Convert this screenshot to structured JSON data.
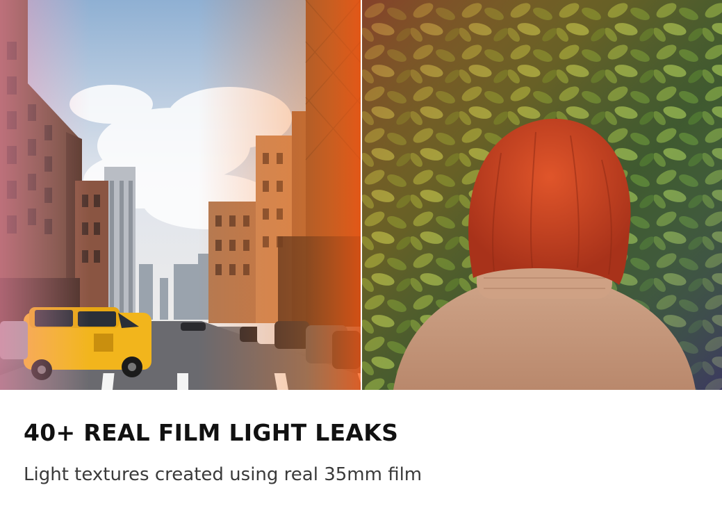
{
  "title": "40+ REAL FILM LIGHT LEAKS",
  "subtitle": "Light textures created using real 35mm film",
  "colors": {
    "title_text": "#111111",
    "subtitle_text": "#3a3a3a",
    "taxi_yellow": "#f2b51c",
    "leak_orange": "#e8641c",
    "hair_red": "#c4401c",
    "sweater": "#c79a7e"
  },
  "images": {
    "left_photo": "city-street-light-leak-photo",
    "right_photo": "woman-in-foliage-light-leak-photo"
  }
}
